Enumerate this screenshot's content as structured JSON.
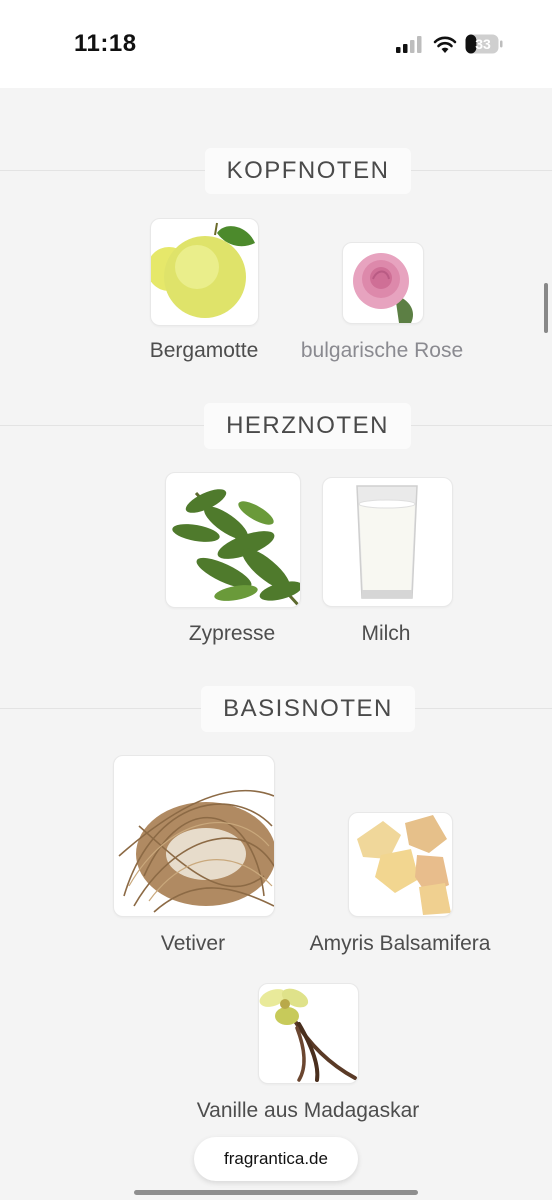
{
  "status_bar": {
    "time": "11:18",
    "battery": "33",
    "battery_level": 0.33
  },
  "sections": [
    {
      "title": "KOPFNOTEN",
      "notes": [
        {
          "name": "Bergamotte",
          "icon": "bergamot-image"
        },
        {
          "name": "bulgarische Rose",
          "icon": "rose-image"
        }
      ]
    },
    {
      "title": "HERZNOTEN",
      "notes": [
        {
          "name": "Zypresse",
          "icon": "cypress-image"
        },
        {
          "name": "Milch",
          "icon": "milk-glass-image"
        }
      ]
    },
    {
      "title": "BASISNOTEN",
      "notes": [
        {
          "name": "Vetiver",
          "icon": "vetiver-roots-image"
        },
        {
          "name": "Amyris Balsamifera",
          "icon": "amyris-resin-image"
        },
        {
          "name": "Vanille aus Madagaskar",
          "icon": "vanilla-image"
        }
      ]
    }
  ],
  "footer": {
    "site": "fragrantica.de"
  }
}
